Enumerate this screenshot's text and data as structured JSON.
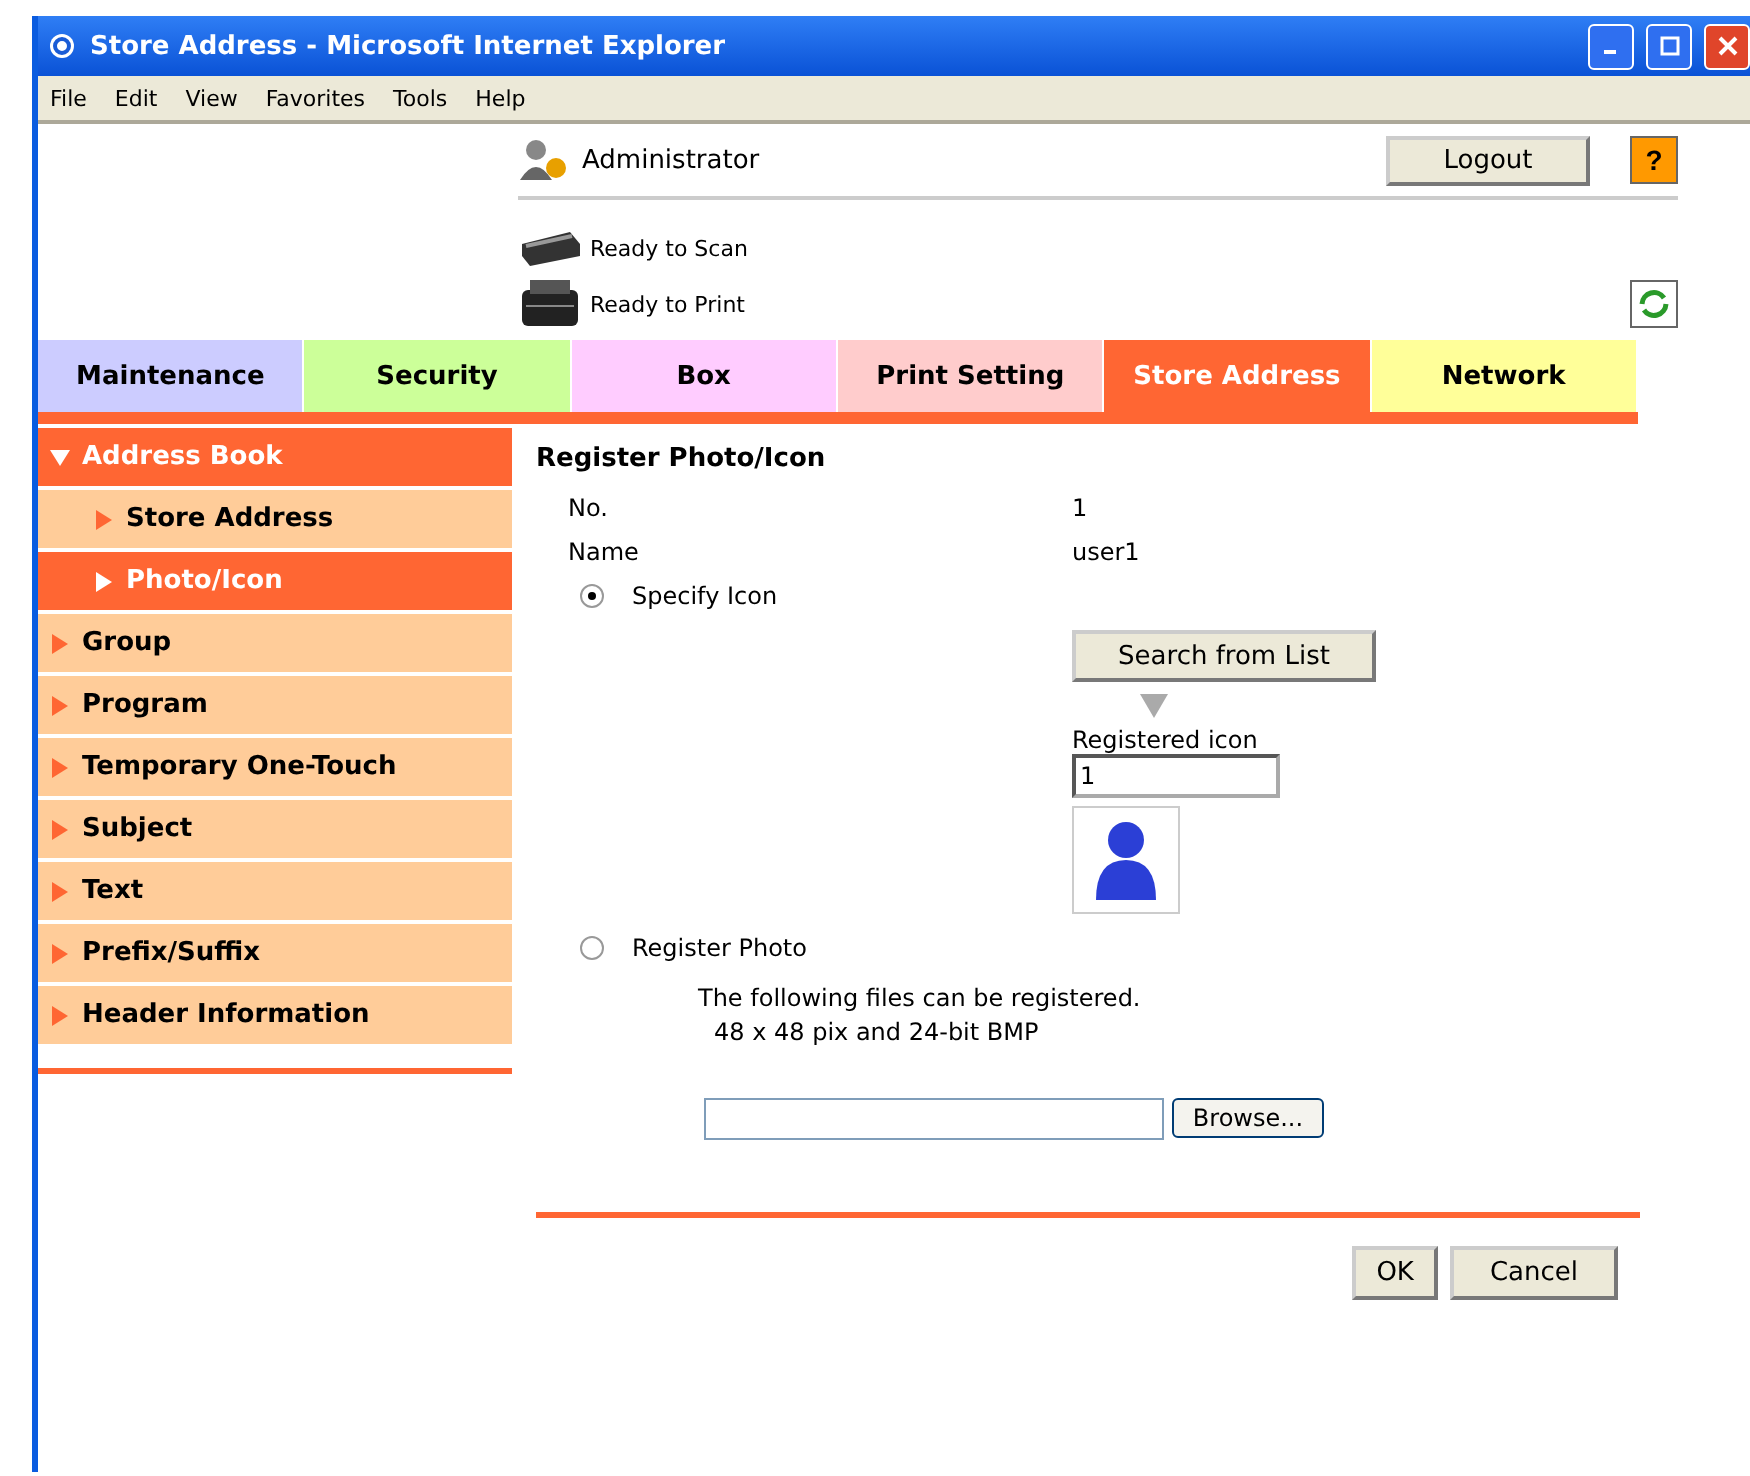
{
  "window": {
    "title": "Store Address - Microsoft Internet Explorer"
  },
  "menu": [
    "File",
    "Edit",
    "View",
    "Favorites",
    "Tools",
    "Help"
  ],
  "header": {
    "user": "Administrator",
    "logout": "Logout",
    "help": "?",
    "statuses": [
      {
        "kind": "scanner",
        "text": "Ready to Scan"
      },
      {
        "kind": "printer",
        "text": "Ready to Print"
      }
    ]
  },
  "tabs": [
    {
      "label": "Maintenance",
      "color": "#ccccff",
      "selected": false
    },
    {
      "label": "Security",
      "color": "#ccff99",
      "selected": false
    },
    {
      "label": "Box",
      "color": "#ffccff",
      "selected": false
    },
    {
      "label": "Print Setting",
      "color": "#ffcccc",
      "selected": false
    },
    {
      "label": "Store Address",
      "color": "#ff6633",
      "selected": true
    },
    {
      "label": "Network",
      "color": "#ffff99",
      "selected": false
    }
  ],
  "sidebar": {
    "items": [
      {
        "label": "Address Book",
        "expanded": true,
        "children": [
          {
            "label": "Store Address",
            "selected": false
          },
          {
            "label": "Photo/Icon",
            "selected": true
          }
        ]
      },
      {
        "label": "Group",
        "expanded": false
      },
      {
        "label": "Program",
        "expanded": false
      },
      {
        "label": "Temporary One-Touch",
        "expanded": false
      },
      {
        "label": "Subject",
        "expanded": false
      },
      {
        "label": "Text",
        "expanded": false
      },
      {
        "label": "Prefix/Suffix",
        "expanded": false
      },
      {
        "label": "Header Information",
        "expanded": false
      }
    ]
  },
  "form": {
    "title": "Register Photo/Icon",
    "fields": [
      {
        "label": "No.",
        "value": "1"
      },
      {
        "label": "Name",
        "value": "user1"
      }
    ],
    "specify_icon": {
      "label": "Specify Icon",
      "selected": true,
      "search_button": "Search from List",
      "registered_label": "Registered icon",
      "registered_value": "1"
    },
    "register_photo": {
      "label": "Register Photo",
      "selected": false,
      "note": "The following files can be registered.",
      "formats": "48 x 48 pix and 24-bit BMP",
      "browse": "Browse..."
    },
    "buttons": [
      "OK",
      "Cancel"
    ]
  }
}
